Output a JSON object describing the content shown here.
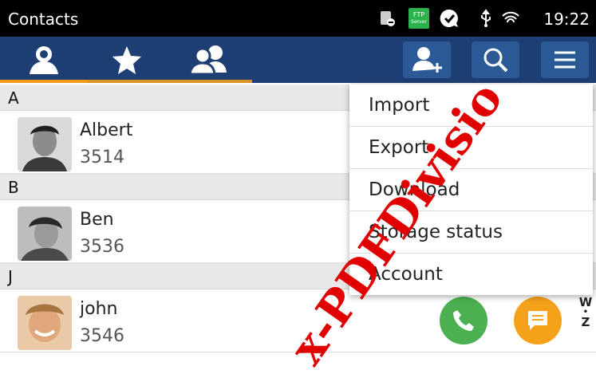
{
  "statusbar": {
    "title": "Contacts",
    "time": "19:22",
    "ftp_line1": "FTP",
    "ftp_line2": "Server"
  },
  "toolbar": {
    "tabs": [
      {
        "icon": "person-icon"
      },
      {
        "icon": "star-icon"
      },
      {
        "icon": "group-icon"
      }
    ],
    "actions": [
      {
        "icon": "add-contact-icon"
      },
      {
        "icon": "search-icon"
      },
      {
        "icon": "menu-icon"
      }
    ]
  },
  "contacts": {
    "sections": [
      {
        "letter": "A",
        "entries": [
          {
            "name": "Albert",
            "number": "3514"
          }
        ]
      },
      {
        "letter": "B",
        "entries": [
          {
            "name": "Ben",
            "number": "3536"
          }
        ]
      },
      {
        "letter": "J",
        "entries": [
          {
            "name": "john",
            "number": "3546"
          }
        ]
      }
    ]
  },
  "menu": {
    "items": [
      "Import",
      "Export",
      "Download",
      "Storage status",
      "Account"
    ]
  },
  "index_bar": {
    "top": "W",
    "dot": "•",
    "bottom": "Z"
  },
  "watermark": "x-PDFDivisio",
  "colors": {
    "toolbar": "#1e3f73",
    "accent": "#f29c1a",
    "call": "#4caf50",
    "message": "#f5a11a"
  }
}
